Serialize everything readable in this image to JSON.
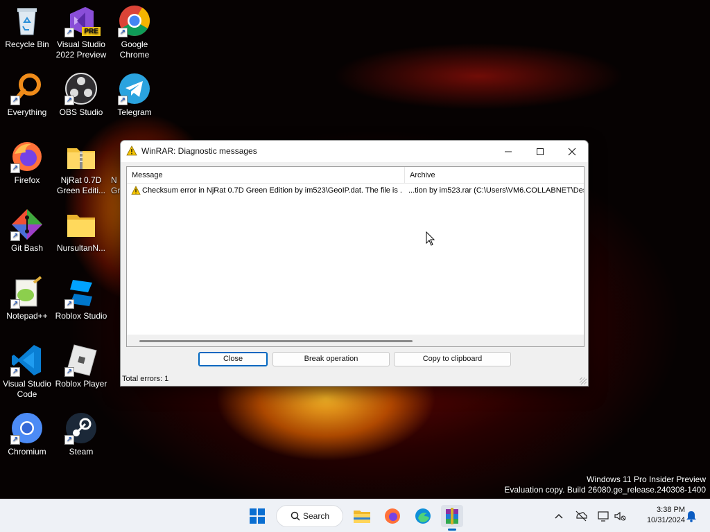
{
  "desktop": {
    "icons": [
      {
        "label": "Recycle Bin",
        "icon": "recycle-bin-icon"
      },
      {
        "label": "Visual Studio 2022 Preview",
        "icon": "visual-studio-icon",
        "badge": "PRE"
      },
      {
        "label": "Google Chrome",
        "icon": "chrome-icon"
      },
      {
        "label": "Everything",
        "icon": "everything-search-icon"
      },
      {
        "label": "OBS Studio",
        "icon": "obs-icon"
      },
      {
        "label": "Telegram",
        "icon": "telegram-icon"
      },
      {
        "label": "Firefox",
        "icon": "firefox-icon"
      },
      {
        "label": "NjRat 0.7D Green Editi...",
        "icon": "zip-folder-icon"
      },
      {
        "label": "N Gr",
        "icon": "folder-icon"
      },
      {
        "label": "Git Bash",
        "icon": "git-bash-icon"
      },
      {
        "label": "NursultanN...",
        "icon": "folder-icon"
      },
      {
        "label": "Notepad++",
        "icon": "notepadpp-icon"
      },
      {
        "label": "Roblox Studio",
        "icon": "roblox-studio-icon"
      },
      {
        "label": "Visual Studio Code",
        "icon": "vscode-icon"
      },
      {
        "label": "Roblox Player",
        "icon": "roblox-player-icon"
      },
      {
        "label": "Chromium",
        "icon": "chromium-icon"
      },
      {
        "label": "Steam",
        "icon": "steam-icon"
      }
    ]
  },
  "dialog": {
    "title": "WinRAR: Diagnostic messages",
    "columns": {
      "message": "Message",
      "archive": "Archive"
    },
    "rows": [
      {
        "message": "Checksum error in NjRat 0.7D Green Edition by im523\\GeoIP.dat. The file is ...",
        "archive": "...tion by im523.rar (C:\\Users\\VM6.COLLABNET\\Des"
      }
    ],
    "buttons": {
      "close": "Close",
      "break": "Break operation",
      "copy": "Copy to clipboard"
    },
    "status": "Total errors: 1"
  },
  "watermark": {
    "line1": "Windows 11 Pro Insider Preview",
    "line2": "Evaluation copy. Build 26080.ge_release.240308-1400"
  },
  "taskbar": {
    "search_label": "Search",
    "time": "3:38 PM",
    "date": "10/31/2024"
  },
  "colors": {
    "accent": "#0067c0",
    "warning": "#f5c400"
  }
}
